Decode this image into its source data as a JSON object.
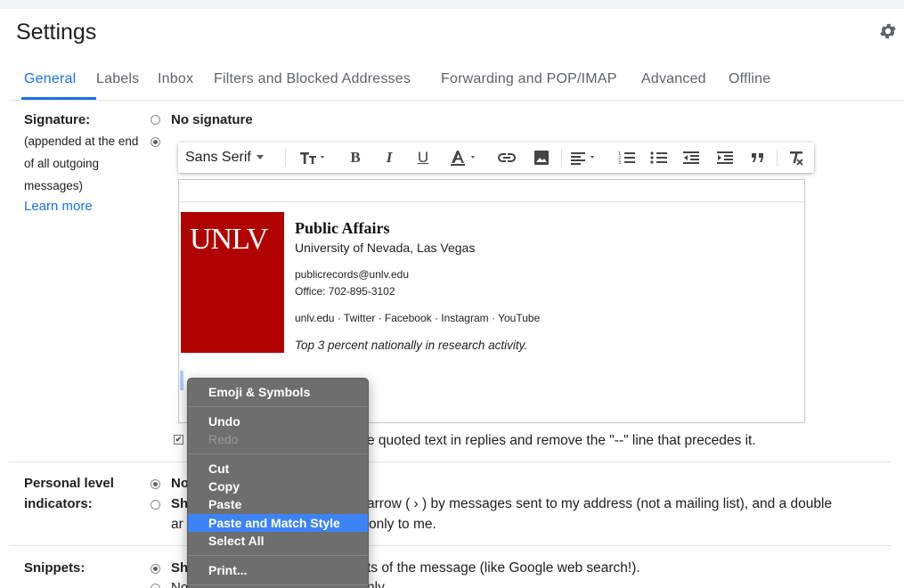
{
  "header": {
    "title": "Settings"
  },
  "tabs": [
    {
      "label": "General"
    },
    {
      "label": "Labels"
    },
    {
      "label": "Inbox"
    },
    {
      "label": "Filters and Blocked Addresses"
    },
    {
      "label": "Forwarding and POP/IMAP"
    },
    {
      "label": "Advanced"
    },
    {
      "label": "Offline"
    }
  ],
  "signature": {
    "label": "Signature:",
    "desc": [
      "(appended at the end",
      "of all outgoing",
      "messages)"
    ],
    "learn_more": "Learn more",
    "no_signature": "No signature",
    "quoted_text": "e quoted text in replies and remove the \"--\" line that precedes it."
  },
  "toolbar": {
    "font": "Sans Serif"
  },
  "sig": {
    "logo": "UNLV",
    "name": "Public Affairs",
    "org": "University of Nevada, Las Vegas",
    "email": "publicrecords@unlv.edu",
    "office": "Office: 702-895-3102",
    "links": "unlv.edu · Twitter · Facebook · Instagram · YouTube",
    "tagline": "Top 3 percent nationally in research activity."
  },
  "personal": {
    "label1": "Personal level",
    "label2": "indicators:",
    "opt1": "No",
    "opt2a": "Sh",
    "opt2b": "arrow ( › ) by messages sent to my address (not a mailing list), and a double",
    "opt2c": "ar",
    "opt2d": "only to me."
  },
  "snippets": {
    "label": "Snippets:",
    "opt1a": "Sh",
    "opt1b": "ts of the message (like Google web search!).",
    "opt2a": "No",
    "opt2b": "nly."
  },
  "context_menu": {
    "items": [
      "Emoji & Symbols",
      "Undo",
      "Redo",
      "Cut",
      "Copy",
      "Paste",
      "Paste and Match Style",
      "Select All",
      "Print..."
    ]
  }
}
